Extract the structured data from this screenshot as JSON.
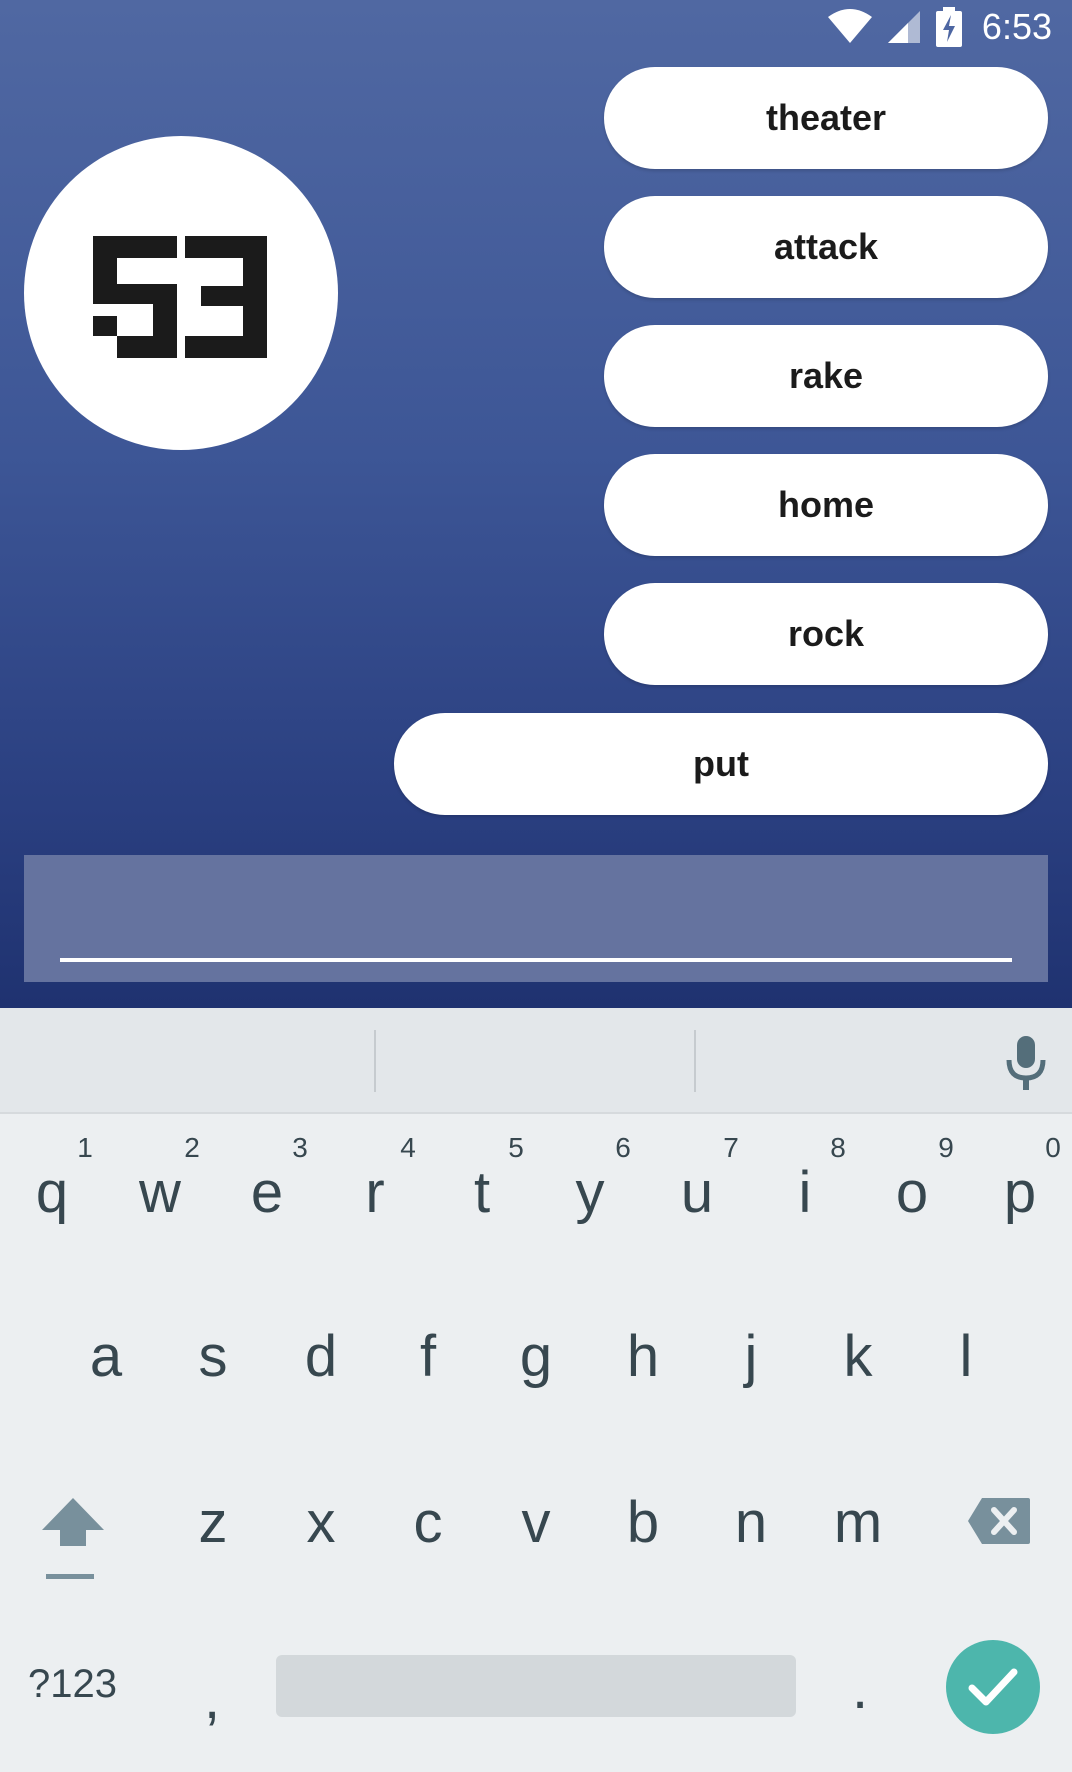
{
  "status_bar": {
    "time": "6:53",
    "icons": [
      "wifi-icon",
      "cell-signal-icon",
      "battery-charging-icon"
    ]
  },
  "game": {
    "timer_value": "53",
    "words": [
      "theater",
      "attack",
      "rake",
      "home",
      "rock",
      "put"
    ],
    "input_value": ""
  },
  "keyboard": {
    "row1": [
      "q",
      "w",
      "e",
      "r",
      "t",
      "y",
      "u",
      "i",
      "o",
      "p"
    ],
    "row1_hints": [
      "1",
      "2",
      "3",
      "4",
      "5",
      "6",
      "7",
      "8",
      "9",
      "0"
    ],
    "row2": [
      "a",
      "s",
      "d",
      "f",
      "g",
      "h",
      "j",
      "k",
      "l"
    ],
    "row3": [
      "z",
      "x",
      "c",
      "v",
      "b",
      "n",
      "m"
    ],
    "symbols_label": "?123",
    "comma": ",",
    "period": ".",
    "icons": [
      "mic-icon",
      "shift-icon",
      "backspace-icon",
      "check-icon"
    ],
    "accent_color": "#4db6ac"
  }
}
